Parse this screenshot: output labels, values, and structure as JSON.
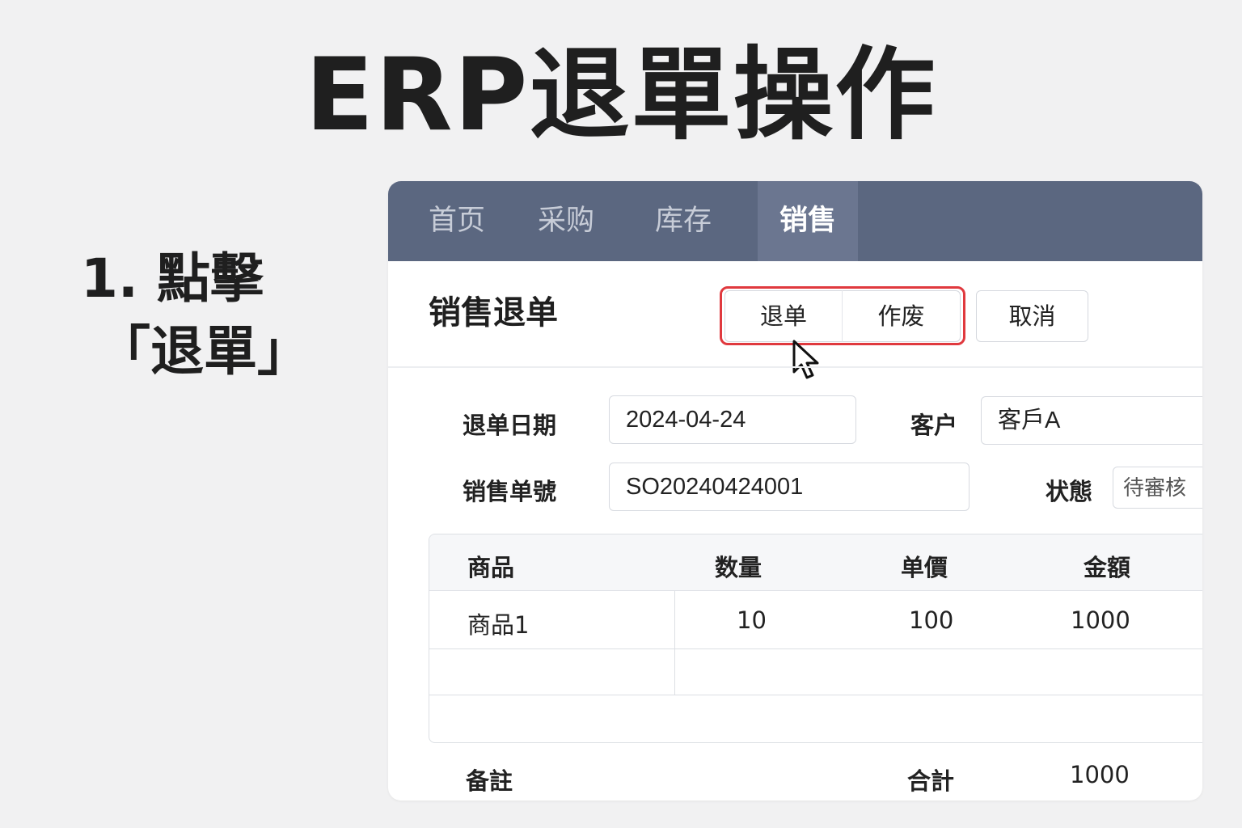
{
  "page": {
    "title": "ERP退單操作",
    "step_line1": "1. 點擊",
    "step_line2": "「退單」"
  },
  "nav": {
    "tabs": [
      {
        "label": "首页",
        "active": false
      },
      {
        "label": "采购",
        "active": false
      },
      {
        "label": "库存",
        "active": false
      },
      {
        "label": "销售",
        "active": true
      }
    ]
  },
  "form": {
    "title": "销售退单",
    "buttons": {
      "return_label": "退单",
      "void_label": "作废",
      "cancel_label": "取消"
    },
    "fields": {
      "return_date_label": "退单日期",
      "return_date_value": "2024-04-24",
      "customer_label": "客户",
      "customer_value": "客戶A",
      "sales_order_label": "销售单號",
      "sales_order_value": "SO20240424001",
      "status_label": "状態",
      "status_value": "待審核"
    }
  },
  "table": {
    "columns": [
      "商品",
      "数量",
      "单價",
      "金額"
    ],
    "rows": [
      [
        "商品1",
        "10",
        "100",
        "1000"
      ]
    ]
  },
  "footer": {
    "remark_label": "备註",
    "total_label": "合計",
    "total_value": "1000"
  },
  "colors": {
    "nav_background": "#5b6780",
    "nav_active": "#6b7690",
    "highlight_border": "#e0393e",
    "page_background": "#f1f1f2"
  },
  "icons": {
    "cursor": "mouse-pointer-icon"
  }
}
